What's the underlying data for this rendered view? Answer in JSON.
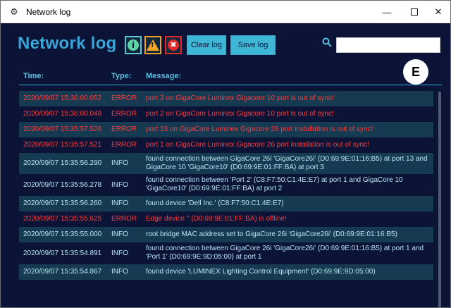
{
  "window": {
    "title": "Network log",
    "icon": "gear-icon",
    "controls": {
      "minimize": "—",
      "close": "✕"
    }
  },
  "app": {
    "title": "Network log",
    "filters": {
      "info": {
        "icon": "info-icon",
        "glyph": "i"
      },
      "warning": {
        "icon": "warning-icon",
        "glyph": "!"
      },
      "error": {
        "icon": "error-icon",
        "glyph": "✖"
      }
    },
    "buttons": {
      "clear": "Clear log",
      "save": "Save log"
    },
    "search": {
      "value": "",
      "placeholder": ""
    },
    "badge": "E"
  },
  "columns": {
    "time": "Time:",
    "type": "Type:",
    "message": "Message:"
  },
  "colors": {
    "background": "#0b1437",
    "accent": "#40b6d6",
    "error_text": "#ff3b3b",
    "info_text": "#b9e6f4",
    "row_alt": "#153a52"
  },
  "rows": [
    {
      "time": "2020/09/07 15:36:00.052",
      "type": "ERROR",
      "message": "port 3 on GigaCore Luminex Gigacore 10 port is out of sync!"
    },
    {
      "time": "2020/09/07 15:36:00.048",
      "type": "ERROR",
      "message": "port 2 on GigaCore Luminex Gigacore 10 port is out of sync!"
    },
    {
      "time": "2020/09/07 15:35:57.526",
      "type": "ERROR",
      "message": "port 13 on GigaCore Luminex Gigacore 26 port installation is out of sync!"
    },
    {
      "time": "2020/09/07 15:35:57.521",
      "type": "ERROR",
      "message": "port 1 on GigaCore Luminex Gigacore 26 port installation is out of sync!"
    },
    {
      "time": "2020/09/07 15:35:56.290",
      "type": "INFO",
      "message": "found connection between GigaCore 26i 'GigaCore26i' (D0:69:9E:01:16:B5) at port 13 and GigaCore 10 'GigaCore10' (D0:69:9E:01:FF:BA) at port 3"
    },
    {
      "time": "2020/09/07 15:35:56.278",
      "type": "INFO",
      "message": "found connection between 'Port 2' (C8:F7:50:C1:4E:E7) at port 1 and GigaCore 10 'GigaCore10' (D0:69:9E:01:FF:BA) at port 2"
    },
    {
      "time": "2020/09/07 15:35:56.260",
      "type": "INFO",
      "message": "found device 'Dell Inc.' (C8:F7:50:C1:4E:E7)"
    },
    {
      "time": "2020/09/07 15:35:55.625",
      "type": "ERROR",
      "message": "Edge device '' (D0:69:9E:01:FF:BA) is offline!"
    },
    {
      "time": "2020/09/07 15:35:55.000",
      "type": "INFO",
      "message": "root bridge MAC address set to GigaCore 26i 'GigaCore26i' (D0:69:9E:01:16:B5)"
    },
    {
      "time": "2020/09/07 15:35:54.891",
      "type": "INFO",
      "message": "found connection between GigaCore 26i 'GigaCore26i' (D0:69:9E:01:16:B5) at port 1 and 'Port 1' (D0:69:9E:9D:05:00) at port 1"
    },
    {
      "time": "2020/09/07 15:35:54.867",
      "type": "INFO",
      "message": "found device 'LUMINEX Lighting Control Equipment' (D0:69:9E:9D:05:00)"
    }
  ]
}
